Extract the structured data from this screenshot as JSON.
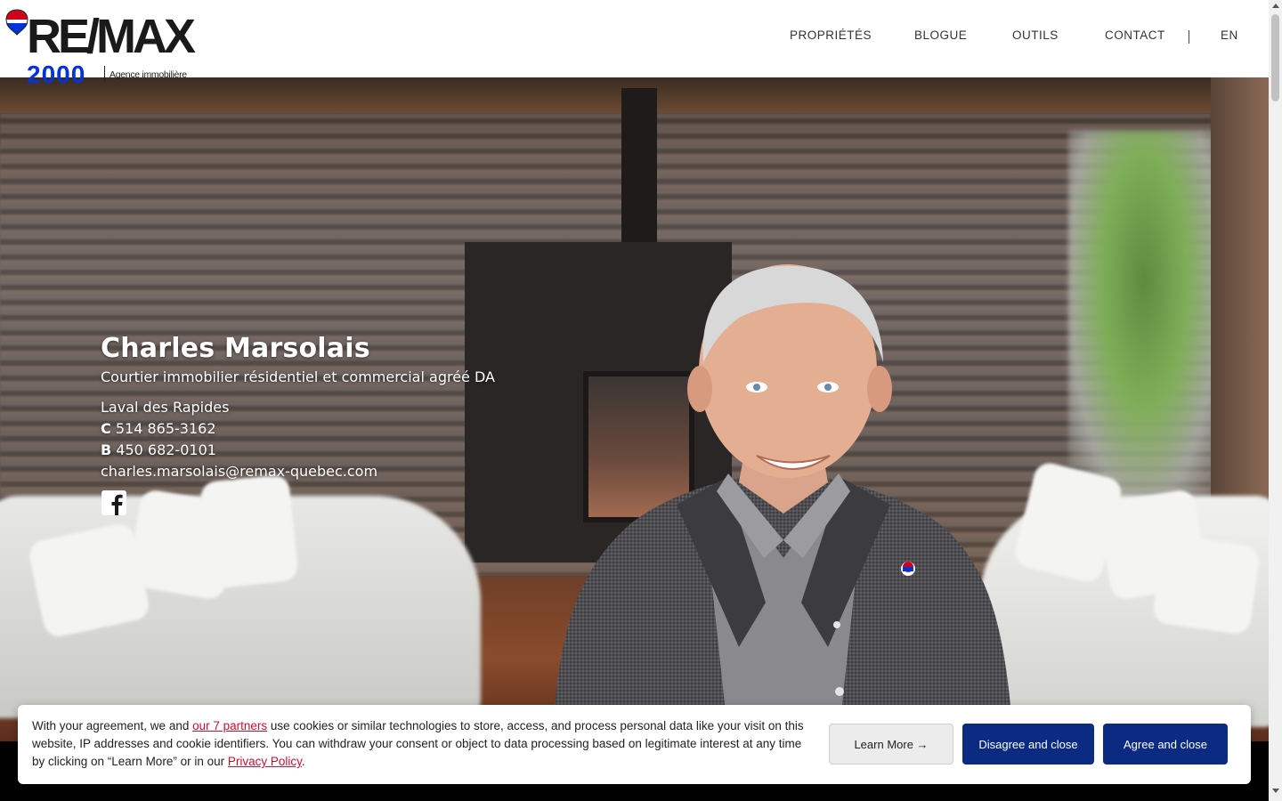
{
  "brand": {
    "logo_word": "RE/MAX",
    "logo_number": "2000",
    "logo_tagline": "Agence immobilière",
    "balloon_colors": [
      "#d0021b",
      "#ffffff",
      "#0033d9"
    ]
  },
  "nav": {
    "items": [
      {
        "label": "PROPRIÉTÉS"
      },
      {
        "label": "BLOGUE"
      },
      {
        "label": "OUTILS"
      },
      {
        "label": "CONTACT"
      }
    ],
    "language": "EN"
  },
  "agent": {
    "name": "Charles Marsolais",
    "title": "Courtier immobilier résidentiel et commercial agréé DA",
    "office": "Laval des Rapides",
    "cell_prefix": "C",
    "cell": "514 865-3162",
    "office_prefix": "B",
    "office_phone": "450 682-0101",
    "email": "charles.marsolais@remax-quebec.com",
    "social_icon": "facebook-icon"
  },
  "cookie": {
    "text_before": "With your agreement, we and ",
    "partners_link": "our 7 partners",
    "text_middle": " use cookies or similar technologies to store, access, and process personal data like your visit on this website, IP addresses and cookie identifiers. You can withdraw your consent or object to data processing based on legitimate interest at any time by clicking on “Learn More” or in our ",
    "privacy_link": "Privacy Policy",
    "text_after": ".",
    "learn_more": "Learn More →",
    "disagree": "Disagree and close",
    "agree": "Agree and close"
  },
  "colors": {
    "brand_blue": "#0033d9",
    "button_navy": "#0b2a82",
    "link_red": "#c8102e"
  }
}
